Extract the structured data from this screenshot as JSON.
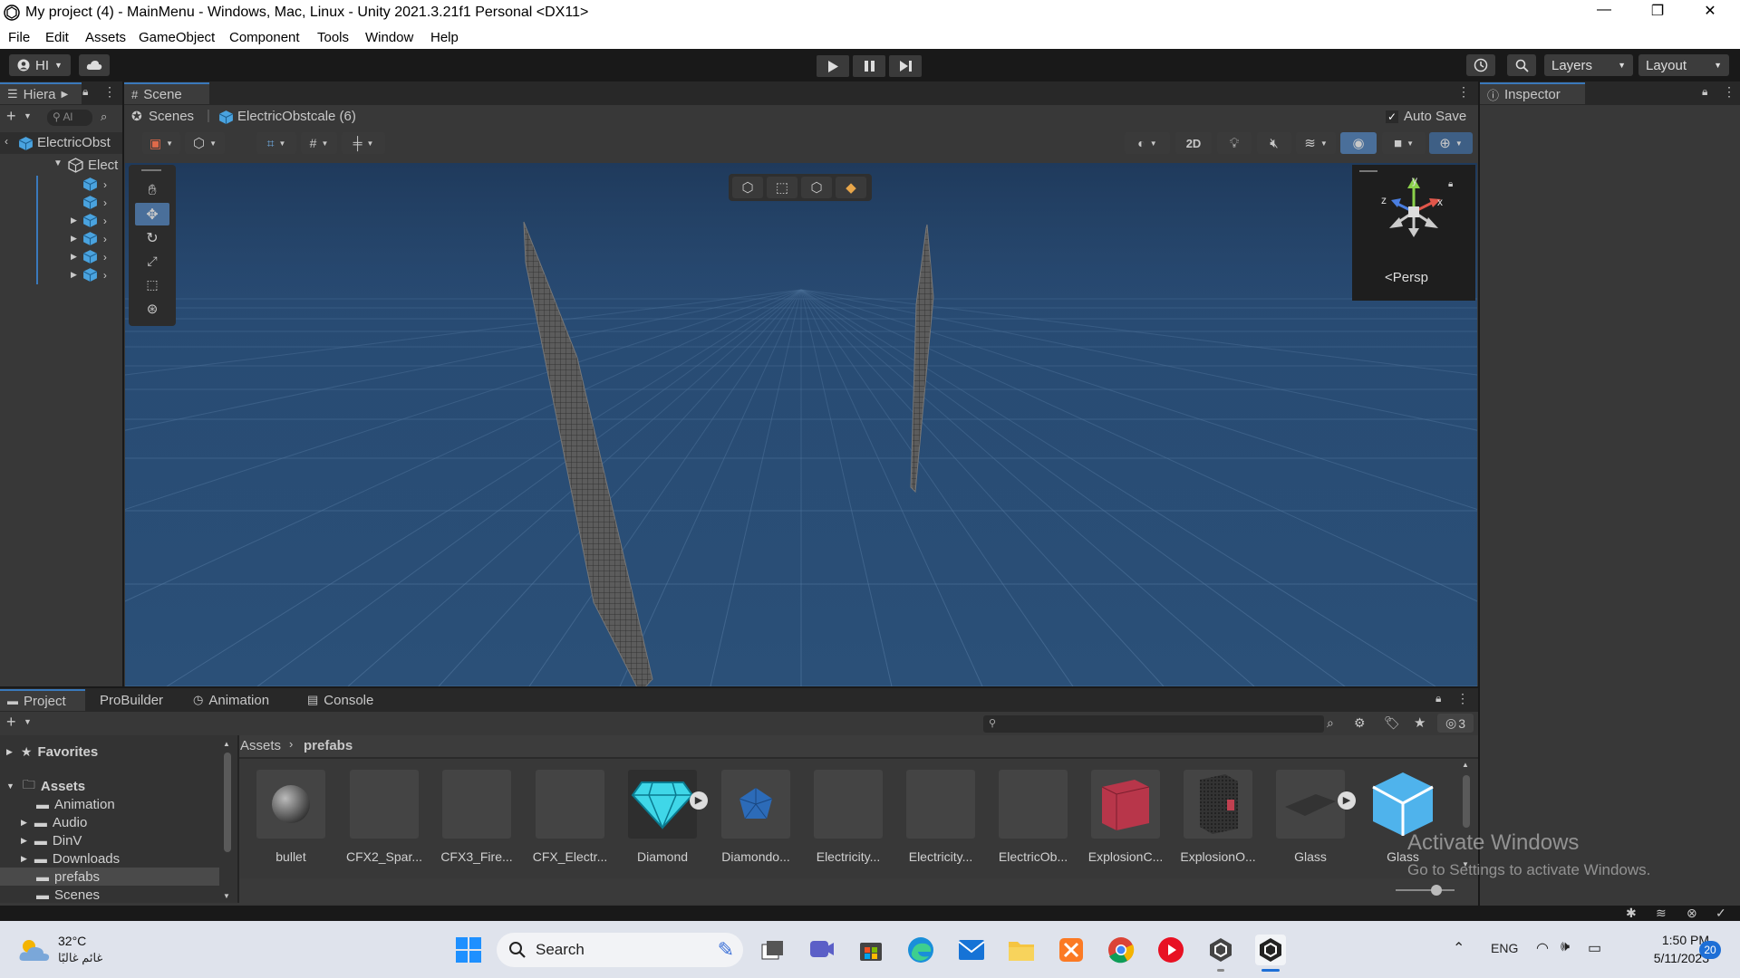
{
  "window": {
    "title": "My project (4) - MainMenu - Windows, Mac, Linux - Unity 2021.3.21f1 Personal <DX11>",
    "minimize": "—",
    "maximize": "❐",
    "close": "✕"
  },
  "menu": [
    "File",
    "Edit",
    "Assets",
    "GameObject",
    "Component",
    "Tools",
    "Window",
    "Help"
  ],
  "toolbar": {
    "account": "HI",
    "layers": "Layers",
    "layout": "Layout"
  },
  "hierarchy": {
    "tab": "Hiera",
    "search_placeholder": "Al",
    "root": "ElectricObst",
    "child": "Elect"
  },
  "scene": {
    "tab": "Scene",
    "breadcrumb_scenes": "Scenes",
    "breadcrumb_object": "ElectricObstcale (6)",
    "auto_save": "Auto Save",
    "mode_2d": "2D",
    "persp": "Persp",
    "gizmo_y": "y",
    "gizmo_x": "x",
    "gizmo_z": "z"
  },
  "inspector": {
    "tab": "Inspector"
  },
  "project": {
    "tabs": [
      "Project",
      "ProBuilder",
      "Animation",
      "Console"
    ],
    "favorites": "Favorites",
    "assets_root": "Assets",
    "folders": [
      "Animation",
      "Audio",
      "DinV",
      "Downloads",
      "prefabs",
      "Scenes"
    ],
    "path_root": "Assets",
    "path_current": "prefabs",
    "hidden_count": "3",
    "items": [
      "bullet",
      "CFX2_Spar...",
      "CFX3_Fire...",
      "CFX_Electr...",
      "Diamond",
      "Diamondo...",
      "Electricity...",
      "Electricity...",
      "ElectricOb...",
      "ExplosionC...",
      "ExplosionO...",
      "Glass",
      "Glass"
    ]
  },
  "watermark": {
    "line1": "Activate Windows",
    "line2": "Go to Settings to activate Windows."
  },
  "taskbar": {
    "temp": "32°C",
    "weather_sub": "غائم غالبًا",
    "search": "Search",
    "lang": "ENG",
    "time": "1:50 PM",
    "date": "5/11/2023",
    "notif": "20"
  },
  "colors": {
    "accent": "#3a79bb",
    "scene_sky": "#2b5078",
    "panel": "#383838"
  }
}
